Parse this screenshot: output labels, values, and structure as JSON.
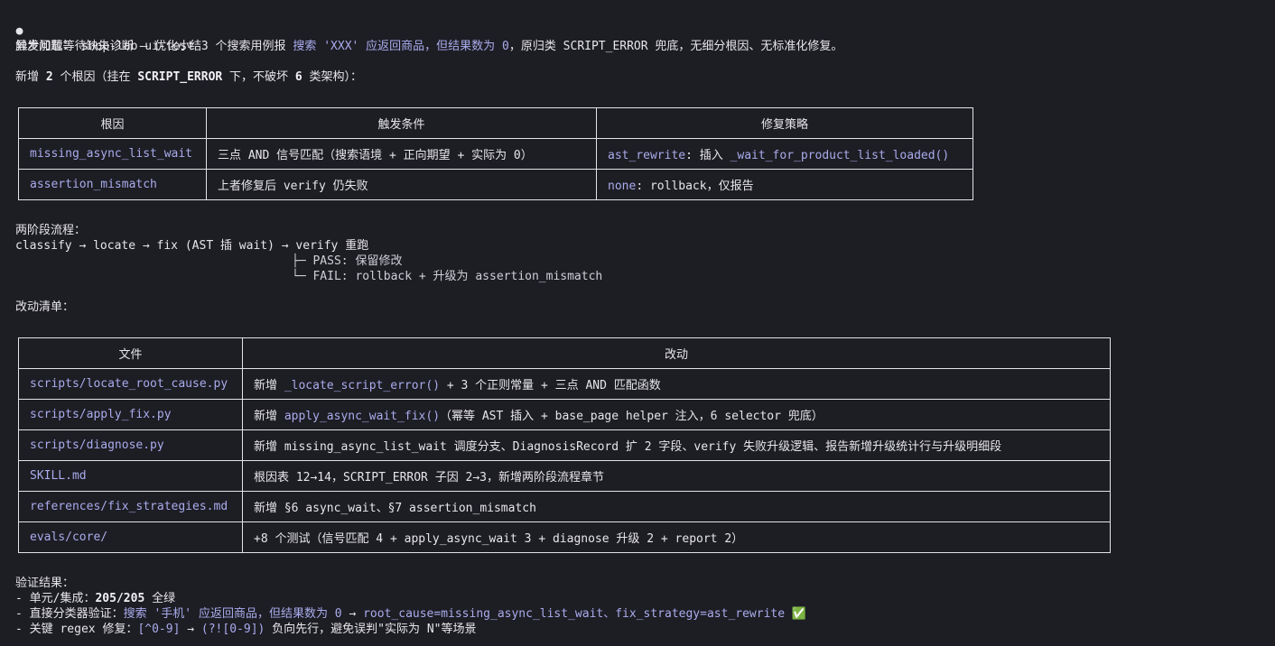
{
  "header": {
    "bullet": "●",
    "title": "异步加载等待缺失诊断 — 优化小结"
  },
  "intro": {
    "label": "触发问题：",
    "p1": " shop-lab-ui-test 3 个搜索用例报 ",
    "p2": "搜索 'XXX' 应返回商品，但结果数为 0",
    "p3": "，原归类 SCRIPT_ERROR 兜底，无细分根因、无标准化修复。"
  },
  "new_causes": {
    "p1": "新增 ",
    "count": "2",
    "p2": " 个根因（挂在 ",
    "category": "SCRIPT_ERROR",
    "p3": " 下，不破坏 ",
    "six": "6",
    "p4": " 类架构）："
  },
  "cause_table": {
    "headers": [
      "根因",
      "触发条件",
      "修复策略"
    ],
    "rows": [
      {
        "cause": "missing_async_list_wait",
        "condition": "三点 AND 信号匹配（搜索语境 + 正向期望 + 实际为 0）",
        "strategy_key": "ast_rewrite",
        "strategy_text": ": 插入 ",
        "strategy_code": "_wait_for_product_list_loaded()"
      },
      {
        "cause": "assertion_mismatch",
        "condition": "上者修复后 verify 仍失败",
        "strategy_key": "none",
        "strategy_text": ": rollback，仅报告",
        "strategy_code": ""
      }
    ]
  },
  "flow": {
    "title": "两阶段流程：",
    "main": "classify → locate → fix (AST 插 wait) → verify 重跑",
    "branch_pass": "├─ PASS: 保留修改",
    "branch_fail": "└─ FAIL: rollback + 升级为 assertion_mismatch"
  },
  "changes": {
    "title": "改动清单：",
    "headers": [
      "文件",
      "改动"
    ],
    "rows": [
      {
        "file": "scripts/locate_root_cause.py",
        "pre": "新增 ",
        "code": "_locate_script_error()",
        "post": " + 3 个正则常量 + 三点 AND 匹配函数"
      },
      {
        "file": "scripts/apply_fix.py",
        "pre": "新增 ",
        "code": "apply_async_wait_fix()",
        "post": "（幂等 AST 插入 + base_page helper 注入，6 selector 兜底）"
      },
      {
        "file": "scripts/diagnose.py",
        "pre": "新增 missing_async_list_wait 调度分支、DiagnosisRecord 扩 2 字段、verify 失败升级逻辑、报告新增升级统计行与升级明细段",
        "code": "",
        "post": ""
      },
      {
        "file": "SKILL.md",
        "pre": "根因表 12→14，SCRIPT_ERROR 子因 2→3，新增两阶段流程章节",
        "code": "",
        "post": ""
      },
      {
        "file": "references/fix_strategies.md",
        "pre": "新增 §6 async_wait、§7 assertion_mismatch",
        "code": "",
        "post": ""
      },
      {
        "file": "evals/core/",
        "pre": "+8 个测试（信号匹配 4 + apply_async_wait 3 + diagnose 升级 2 + report 2）",
        "code": "",
        "post": ""
      }
    ]
  },
  "verify": {
    "title": "验证结果：",
    "l1_pre": "- 单元/集成：",
    "l1_val": "205/205",
    "l1_post": " 全绿",
    "l2_pre": "- 直接分类器验证：",
    "l2_q": "搜索 '手机' 应返回商品，但结果数为 0",
    "l2_arrow": " → ",
    "l2_res": "root_cause=missing_async_list_wait、fix_strategy=ast_rewrite",
    "l2_check": " ✅",
    "l3_pre": "- 关键 regex 修复：",
    "l3_a": "[^0-9]",
    "l3_arrow": " → ",
    "l3_b": "(?![0-9])",
    "l3_post": " 负向先行，避免误判\"实际为 N\"等场景"
  },
  "colors": {
    "background": "#1d1d24",
    "accent": "#a9acec",
    "text": "#e6e6ea",
    "check": "#3fb950"
  }
}
